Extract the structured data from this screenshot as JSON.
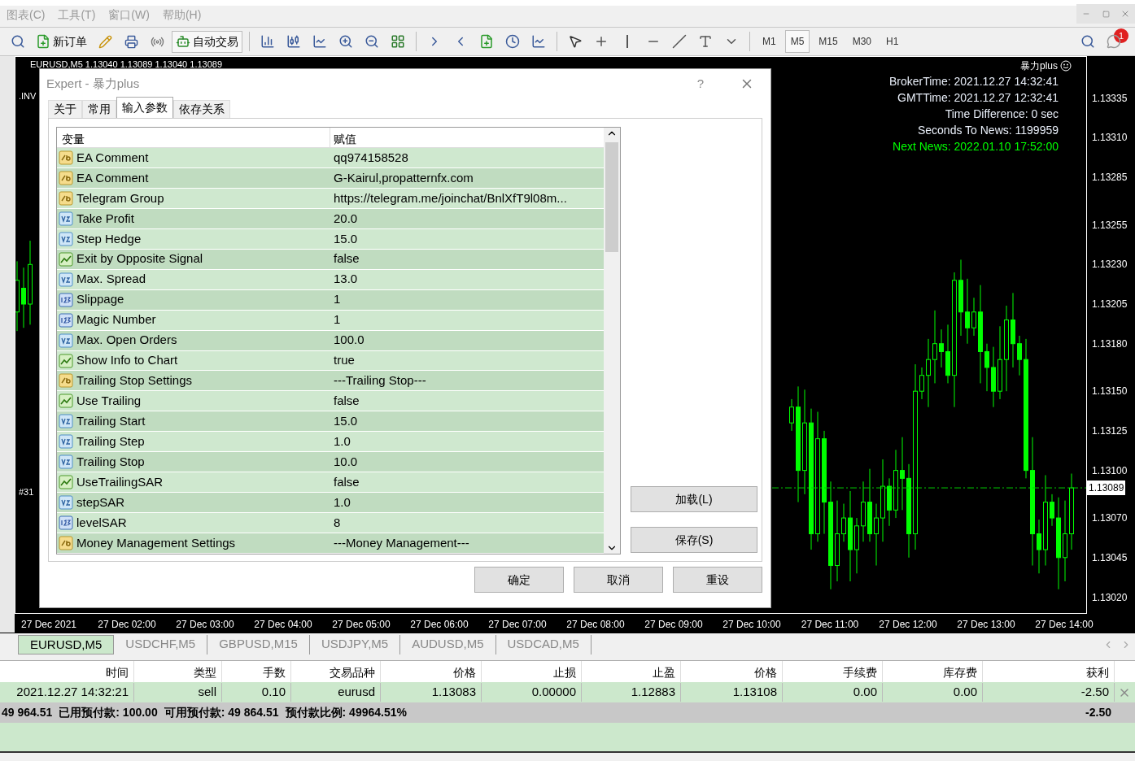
{
  "menu": [
    "图表(C)",
    "工具(T)",
    "窗口(W)",
    "帮助(H)"
  ],
  "toolbar": {
    "new_order": "新订单",
    "auto_trading": "自动交易",
    "timeframes": [
      {
        "label": "M1",
        "selected": false
      },
      {
        "label": "M5",
        "selected": true
      },
      {
        "label": "M15",
        "selected": false
      },
      {
        "label": "M30",
        "selected": false
      },
      {
        "label": "H1",
        "selected": false
      }
    ],
    "notification_count": "1"
  },
  "chart": {
    "header": "EURUSD,M5  1.13040 1.13089 1.13040 1.13089",
    "left_labels": [
      ".INV",
      "#31"
    ],
    "indicator_title": "暴力plus",
    "info_lines": [
      {
        "kind": "info",
        "text": "BrokerTime: 2021.12.27 14:32:41"
      },
      {
        "kind": "info",
        "text": "GMTTime: 2021.12.27 12:32:41"
      },
      {
        "kind": "info",
        "text": "Time Difference: 0 sec"
      },
      {
        "kind": "info",
        "text": "Seconds To News: 1199959"
      },
      {
        "kind": "news",
        "text": "Next News: 2022.01.10 17:52:00"
      }
    ],
    "chart_data": {
      "type": "candlestick",
      "ylim": [
        1.1301,
        1.13361
      ],
      "categories": [
        null,
        null,
        null,
        null,
        null,
        "27 Dec 2021",
        null,
        null,
        null,
        null,
        null,
        null,
        null,
        null,
        null,
        null,
        null,
        "27 Dec 02:00",
        null,
        null,
        null,
        null,
        null,
        null,
        null,
        null,
        null,
        null,
        null,
        "27 Dec 03:00",
        null,
        null,
        null,
        null,
        null,
        null,
        null,
        null,
        null,
        null,
        null,
        "27 Dec 04:00",
        null,
        null,
        null,
        null,
        null,
        null,
        null,
        null,
        null,
        null,
        null,
        "27 Dec 05:00",
        null,
        null,
        null,
        null,
        null,
        null,
        null,
        null,
        null,
        null,
        null,
        "27 Dec 06:00",
        null,
        null,
        null,
        null,
        null,
        null,
        null,
        null,
        null,
        null,
        null,
        "27 Dec 07:00",
        null,
        null,
        null,
        null,
        null,
        null,
        null,
        null,
        null,
        null,
        null,
        "27 Dec 08:00",
        null,
        null,
        null,
        null,
        null,
        null,
        null,
        null,
        null,
        null,
        null,
        "27 Dec 09:00",
        null,
        null,
        null,
        null,
        null,
        null,
        null,
        null,
        null,
        null,
        null,
        "27 Dec 10:00",
        null,
        null,
        null,
        null,
        null,
        null,
        null,
        null,
        null,
        null,
        null,
        "27 Dec 11:00",
        null,
        null,
        null,
        null,
        null,
        null,
        null,
        null,
        null,
        null,
        null,
        "27 Dec 12:00",
        null,
        null,
        null,
        null,
        null,
        null,
        null,
        null,
        null,
        null,
        null,
        "27 Dec 13:00",
        null,
        null,
        null,
        null,
        null,
        null,
        null,
        null,
        null,
        null,
        null,
        "27 Dec 14:00",
        null
      ],
      "yticks": [
        {
          "value": 1.13335,
          "label": "1.13335"
        },
        {
          "value": 1.1331,
          "label": "1.13310"
        },
        {
          "value": 1.13285,
          "label": "1.13285"
        },
        {
          "value": 1.13255,
          "label": "1.13255"
        },
        {
          "value": 1.1323,
          "label": "1.13230"
        },
        {
          "value": 1.13205,
          "label": "1.13205"
        },
        {
          "value": 1.1318,
          "label": "1.13180"
        },
        {
          "value": 1.1315,
          "label": "1.13150"
        },
        {
          "value": 1.13125,
          "label": "1.13125"
        },
        {
          "value": 1.131,
          "label": "1.13100"
        },
        {
          "value": 1.1307,
          "label": "1.13070"
        },
        {
          "value": 1.13045,
          "label": "1.13045"
        },
        {
          "value": 1.1302,
          "label": "1.13020"
        }
      ],
      "ohlc": [
        [
          1.132,
          1.13232,
          1.13188,
          1.1322
        ],
        [
          1.13215,
          1.13228,
          1.1319,
          1.13205
        ],
        [
          1.13205,
          1.13245,
          1.13192,
          1.1323
        ],
        null,
        null,
        null,
        null,
        null,
        null,
        null,
        null,
        null,
        null,
        null,
        null,
        null,
        null,
        null,
        null,
        null,
        null,
        null,
        null,
        null,
        null,
        null,
        null,
        null,
        null,
        null,
        null,
        null,
        null,
        null,
        null,
        null,
        null,
        null,
        null,
        null,
        null,
        null,
        null,
        null,
        null,
        null,
        null,
        null,
        null,
        null,
        null,
        null,
        null,
        null,
        null,
        null,
        null,
        null,
        null,
        null,
        null,
        null,
        null,
        null,
        null,
        null,
        null,
        null,
        null,
        null,
        null,
        null,
        null,
        null,
        null,
        null,
        null,
        null,
        null,
        null,
        null,
        null,
        null,
        null,
        null,
        null,
        null,
        null,
        null,
        null,
        null,
        null,
        null,
        null,
        null,
        null,
        null,
        null,
        null,
        null,
        null,
        null,
        null,
        null,
        null,
        null,
        null,
        null,
        null,
        null,
        null,
        null,
        null,
        null,
        null,
        null,
        null,
        null,
        null,
        [
          1.1313,
          1.13145,
          1.13125,
          1.1314
        ],
        [
          1.1314,
          1.13153,
          1.1308,
          1.131
        ],
        [
          1.131,
          1.13151,
          1.13085,
          1.1313
        ],
        [
          1.1313,
          1.13139,
          1.1305,
          1.1306
        ],
        [
          1.1306,
          1.13137,
          1.13055,
          1.1312
        ],
        [
          1.1312,
          1.13125,
          1.1306,
          1.1308
        ],
        [
          1.1308,
          1.13093,
          1.13025,
          1.1304
        ],
        [
          1.1304,
          1.13081,
          1.1303,
          1.1306
        ],
        [
          1.1306,
          1.13079,
          1.13055,
          1.1307
        ],
        [
          1.1307,
          1.13087,
          1.1303,
          1.1305
        ],
        [
          1.1305,
          1.1307,
          1.13035,
          1.13065
        ],
        [
          1.13065,
          1.13093,
          1.13055,
          1.1308
        ],
        [
          1.1308,
          1.13101,
          1.13055,
          1.1306
        ],
        [
          1.1306,
          1.13079,
          1.1304,
          1.1307
        ],
        [
          1.1307,
          1.13107,
          1.13055,
          1.1309
        ],
        [
          1.1309,
          1.13095,
          1.13065,
          1.13075
        ],
        [
          1.13075,
          1.13113,
          1.1307,
          1.131
        ],
        [
          1.131,
          1.13121,
          1.13075,
          1.13095
        ],
        [
          1.13095,
          1.13104,
          1.13045,
          1.1306
        ],
        [
          1.1306,
          1.13167,
          1.1305,
          1.1315
        ],
        [
          1.1315,
          1.13165,
          1.13145,
          1.1316
        ],
        [
          1.1316,
          1.13183,
          1.1314,
          1.1317
        ],
        [
          1.1317,
          1.13201,
          1.13155,
          1.1318
        ],
        [
          1.1318,
          1.13189,
          1.13165,
          1.13175
        ],
        [
          1.13175,
          1.13192,
          1.13155,
          1.1316
        ],
        [
          1.1316,
          1.13225,
          1.1314,
          1.1322
        ],
        [
          1.1322,
          1.13233,
          1.13185,
          1.132
        ],
        [
          1.132,
          1.13221,
          1.1318,
          1.1319
        ],
        [
          1.1319,
          1.13209,
          1.13185,
          1.132
        ],
        [
          1.132,
          1.13217,
          1.13155,
          1.13175
        ],
        [
          1.13175,
          1.1318,
          1.1315,
          1.13165
        ],
        [
          1.13165,
          1.13178,
          1.1314,
          1.1315
        ],
        [
          1.1315,
          1.13191,
          1.13145,
          1.1317
        ],
        [
          1.1317,
          1.13204,
          1.1315,
          1.13195
        ],
        [
          1.13195,
          1.13212,
          1.13165,
          1.1318
        ],
        [
          1.1318,
          1.13185,
          1.1316,
          1.1317
        ],
        [
          1.1317,
          1.13183,
          1.13095,
          1.131
        ],
        [
          1.131,
          1.13121,
          1.1304,
          1.1306
        ],
        [
          1.1306,
          1.13069,
          1.13035,
          1.1305
        ],
        [
          1.1305,
          1.13097,
          1.1304,
          1.1308
        ],
        [
          1.1308,
          1.13085,
          1.13065,
          1.1307
        ],
        [
          1.1307,
          1.13083,
          1.13025,
          1.13045
        ],
        [
          1.13045,
          1.13081,
          1.1303,
          1.1306
        ],
        [
          1.1306,
          1.13098,
          1.1305,
          1.13089
        ]
      ]
    },
    "current_price": "1.13089"
  },
  "dialog": {
    "title": "Expert - 暴力plus",
    "help": "?",
    "tabs": [
      {
        "label": "关于",
        "selected": false
      },
      {
        "label": "常用",
        "selected": false
      },
      {
        "label": "输入参数",
        "selected": true
      },
      {
        "label": "依存关系",
        "selected": false
      }
    ],
    "columns": [
      "变量",
      "赋值"
    ],
    "rows": [
      {
        "kind": "string",
        "name": "EA Comment",
        "value": "qq974158528"
      },
      {
        "kind": "string",
        "name": "EA Comment",
        "value": "G-Kairul,propatternfx.com"
      },
      {
        "kind": "string",
        "name": "Telegram Group",
        "value": "https://telegram.me/joinchat/BnlXfT9l08m..."
      },
      {
        "kind": "double",
        "name": "Take Profit",
        "value": "20.0"
      },
      {
        "kind": "double",
        "name": "Step Hedge",
        "value": "15.0"
      },
      {
        "kind": "bool",
        "name": "Exit by Opposite Signal",
        "value": "false"
      },
      {
        "kind": "double",
        "name": "Max. Spread",
        "value": "13.0"
      },
      {
        "kind": "int",
        "name": "Slippage",
        "value": "1"
      },
      {
        "kind": "int",
        "name": "Magic Number",
        "value": "1"
      },
      {
        "kind": "double",
        "name": "Max. Open Orders",
        "value": "100.0"
      },
      {
        "kind": "bool",
        "name": "Show Info to Chart",
        "value": "true"
      },
      {
        "kind": "string",
        "name": "Trailing Stop Settings",
        "value": "---Trailing Stop---"
      },
      {
        "kind": "bool",
        "name": "Use Trailing",
        "value": "false"
      },
      {
        "kind": "double",
        "name": "Trailing Start",
        "value": "15.0"
      },
      {
        "kind": "double",
        "name": "Trailing Step",
        "value": "1.0"
      },
      {
        "kind": "double",
        "name": "Trailing Stop",
        "value": "10.0"
      },
      {
        "kind": "bool",
        "name": "UseTrailingSAR",
        "value": "false"
      },
      {
        "kind": "double",
        "name": "stepSAR",
        "value": "1.0"
      },
      {
        "kind": "int",
        "name": "levelSAR",
        "value": "8"
      },
      {
        "kind": "string",
        "name": "Money Management Settings",
        "value": "---Money Management---"
      }
    ],
    "side_buttons": [
      "加载(L)",
      "保存(S)"
    ],
    "buttons": [
      "确定",
      "取消",
      "重设"
    ]
  },
  "symbol_tabs": [
    {
      "label": "EURUSD,M5",
      "selected": true
    },
    {
      "label": "USDCHF,M5",
      "selected": false
    },
    {
      "label": "GBPUSD,M15",
      "selected": false
    },
    {
      "label": "USDJPY,M5",
      "selected": false
    },
    {
      "label": "AUDUSD,M5",
      "selected": false
    },
    {
      "label": "USDCAD,M5",
      "selected": false
    }
  ],
  "trades": {
    "columns": [
      "时间",
      "类型",
      "手数",
      "交易品种",
      "价格",
      "止损",
      "止盈",
      "价格",
      "手续费",
      "库存费",
      "获利"
    ],
    "rows": [
      {
        "cells": [
          "2021.12.27 14:32:21",
          "sell",
          "0.10",
          "eurusd",
          "1.13083",
          "0.00000",
          "1.12883",
          "1.13108",
          "0.00",
          "0.00",
          "-2.50"
        ]
      }
    ],
    "summary": {
      "balance": "49 964.51",
      "items": [
        {
          "label": "已用预付款:",
          "value": "100.00"
        },
        {
          "label": "可用预付款:",
          "value": "49 864.51"
        },
        {
          "label": "预付款比例:",
          "value": "49964.51%"
        }
      ],
      "total": "-2.50"
    }
  }
}
